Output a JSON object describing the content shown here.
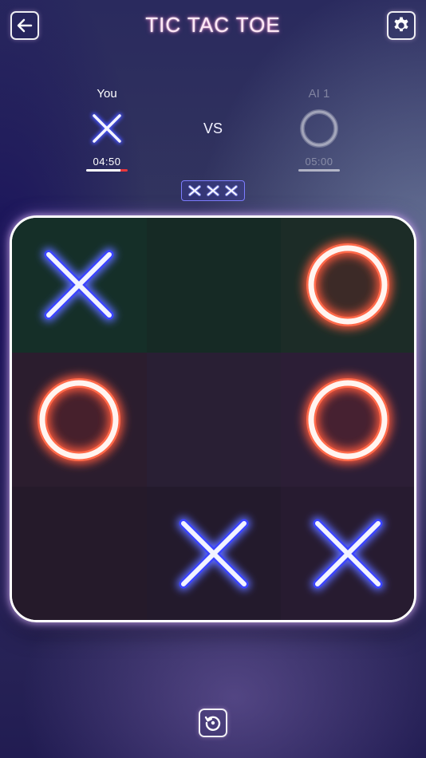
{
  "header": {
    "title": "TIC TAC TOE",
    "back_icon": "arrow-left-icon",
    "settings_icon": "gear-icon"
  },
  "players": [
    {
      "name": "You",
      "mark": "X",
      "time": "04:50",
      "time_remaining_fraction": 0.83,
      "active": true
    },
    {
      "name": "AI 1",
      "mark": "O",
      "time": "05:00",
      "time_remaining_fraction": 1.0,
      "active": false
    }
  ],
  "vs_label": "VS",
  "streak": [
    "X",
    "X",
    "X"
  ],
  "board": [
    "X",
    "",
    "O",
    "O",
    "",
    "O",
    "",
    "X",
    "X"
  ],
  "colors": {
    "x": "#5c6bff",
    "o": "#ff5a3c",
    "timer_alert": "#e8363c",
    "board_border": "#ffffff"
  },
  "footer": {
    "reset_icon": "restart-icon"
  }
}
